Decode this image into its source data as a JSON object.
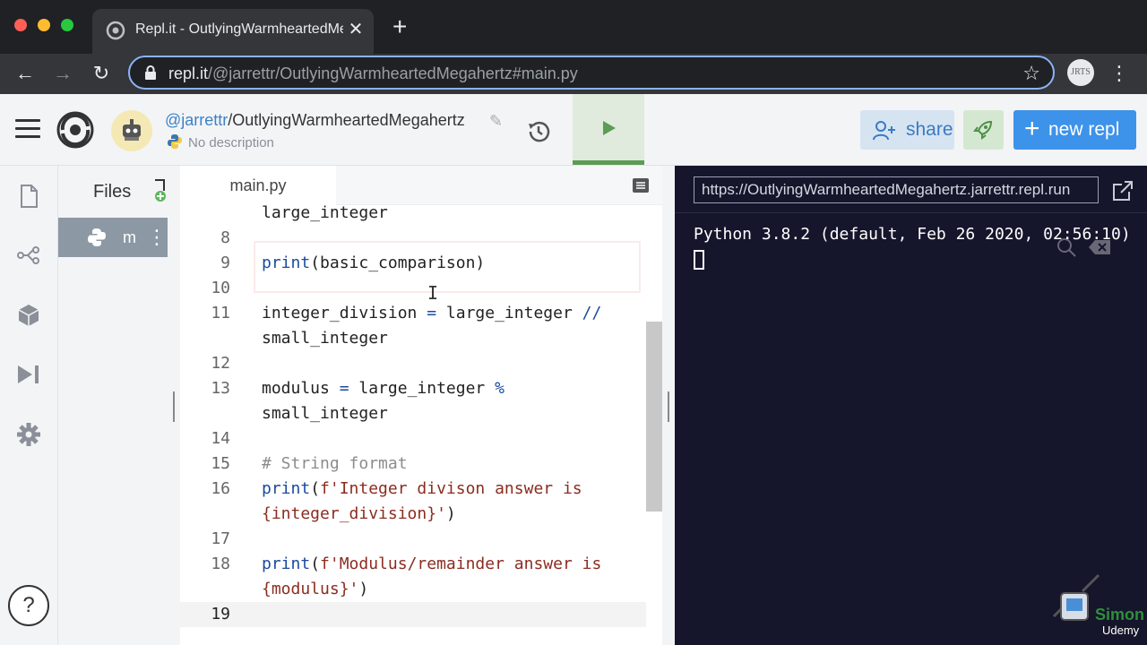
{
  "browser": {
    "tab_title": "Repl.it - OutlyingWarmheartedMegahertz",
    "url_host": "repl.it",
    "url_path": "/@jarrettr/OutlyingWarmheartedMegahertz#main.py",
    "profile_initials": "JRTS"
  },
  "header": {
    "username": "@jarrettr",
    "repl_name": "/OutlyingWarmheartedMegahertz",
    "description": "No description",
    "share_label": "share",
    "new_repl_label": "new repl"
  },
  "files": {
    "title": "Files",
    "items": [
      {
        "label": "m"
      }
    ]
  },
  "editor": {
    "tab_label": "main.py"
  },
  "console": {
    "url": "https://OutlyingWarmheartedMegahertz.jarrettr.repl.run",
    "output": "Python 3.8.2 (default, Feb 26 2020, 02:56:10)"
  },
  "watermark": {
    "brand": "Simon",
    "sub": "Udemy"
  },
  "colors": {
    "accent": "#3d92ea",
    "run_green": "#5c9c56",
    "console_bg": "#15152c"
  }
}
